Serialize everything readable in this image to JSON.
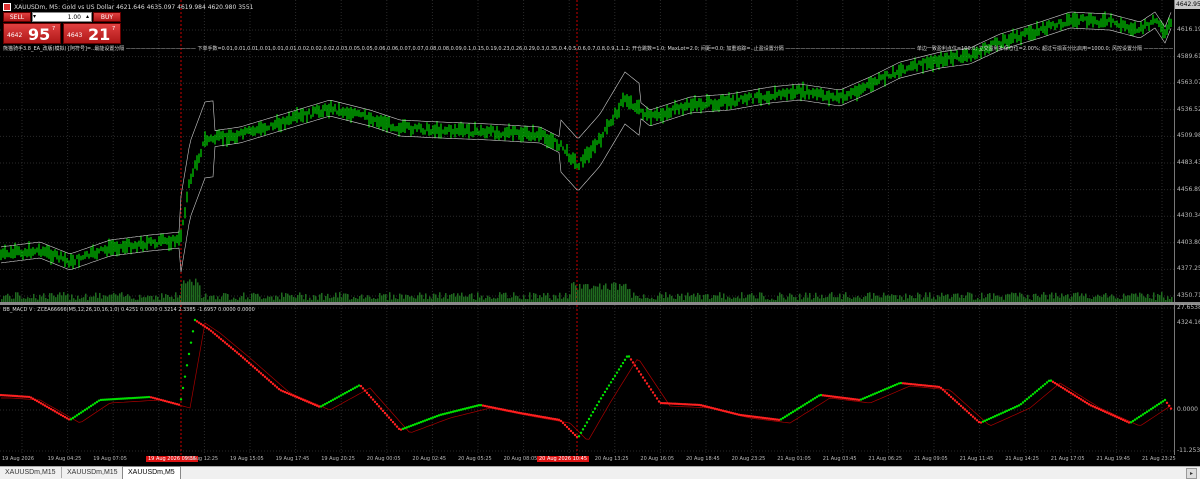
{
  "window": {
    "symbol_title": "XAUUSDm, M5:  Gold vs US Dollar  4621.646 4635.097 4619.984 4620.980  3551"
  },
  "trade_panel": {
    "sell_label": "SELL",
    "buy_label": "BUY",
    "lot_value": "1.00",
    "sell_price": {
      "prefix": "4642",
      "big": "95",
      "sup": "7"
    },
    "buy_price": {
      "prefix": "4643",
      "big": "21",
      "sup": "7"
    }
  },
  "info_line": "熊猫骑手3.8_EA_改版(模拟) [阿符号]=..最能设置分隔 —————————————— 下单手数=0.01,0.01,0.01,0.01,0.01,0.01,0.02,0.02,0.02,0.03,0.05,0.05,0.06,0.06,0.07,0.07,0.08,0.08,0.09,0.1,0.15,0.19,0.23,0.26,0.29,0.3,0.35,0.4,0.5,0.6,0.7,0.8,0.9,1,1.2; 开仓跳数=1.0; MaxLot=2.0; 间距=0.0; 加重追踪=..止盈设置分隔 —————————————————————————— 单边一致盈利点位=100.0; 立交盈利补保仓位=2.00%; 超过亏损百分比启用=1000.0; 风控设置分隔 ——————",
  "main_axis": {
    "labels": [
      "4616.19",
      "4589.61",
      "4563.07",
      "4536.52",
      "4509.98",
      "4483.43",
      "4456.89",
      "4430.34",
      "4403.80",
      "4377.25",
      "4350.71",
      "4324.16"
    ],
    "top_label": "4642.95"
  },
  "macd": {
    "title": "BB_MACD V : ZCEA66666(M5,12,26,10,16,1.0) 0.4251 0.0000 0.3214 2.3385 -1.6957 0.0000 0.0000",
    "axis_labels": [
      "27.6538",
      "0.0000",
      "-11.2535"
    ]
  },
  "time_axis": {
    "labels": [
      "19 Aug 2026",
      "19 Aug 04:25",
      "19 Aug 07:05",
      "19 Aug 0",
      "19 Aug 12:25",
      "19 Aug 15:05",
      "19 Aug 17:45",
      "19 Aug 20:25",
      "20 Aug 00:05",
      "20 Aug 02:45",
      "20 Aug 05:25",
      "20 Aug 08:05",
      "20 Aug 1",
      "20 Aug 13:25",
      "20 Aug 16:05",
      "20 Aug 18:45",
      "20 Aug 23:25",
      "21 Aug 01:05",
      "21 Aug 03:45",
      "21 Aug 06:25",
      "21 Aug 09:05",
      "21 Aug 11:45",
      "21 Aug 14:25",
      "21 Aug 17:05",
      "21 Aug 19:45",
      "21 Aug 23:25"
    ],
    "highlight_1": "19 Aug 2026 09:35",
    "highlight_2": "20 Aug 2026 10:45"
  },
  "tabs": [
    "XAUUSDm,M15",
    "XAUUSDm,M15",
    "XAUUSDm,M5"
  ],
  "colors": {
    "candle_up": "#00ff00",
    "candle_body": "#008000",
    "volume": "#1f6b1f",
    "bands": "#cfcfcf",
    "macd_up": "#00e000",
    "macd_down": "#ff2020",
    "grid": "#2a2a2a",
    "marker_line": "#cc0000"
  },
  "icons": [
    "chart-window-icon",
    "minimize-icon",
    "close-icon",
    "scroll-right-icon"
  ]
}
